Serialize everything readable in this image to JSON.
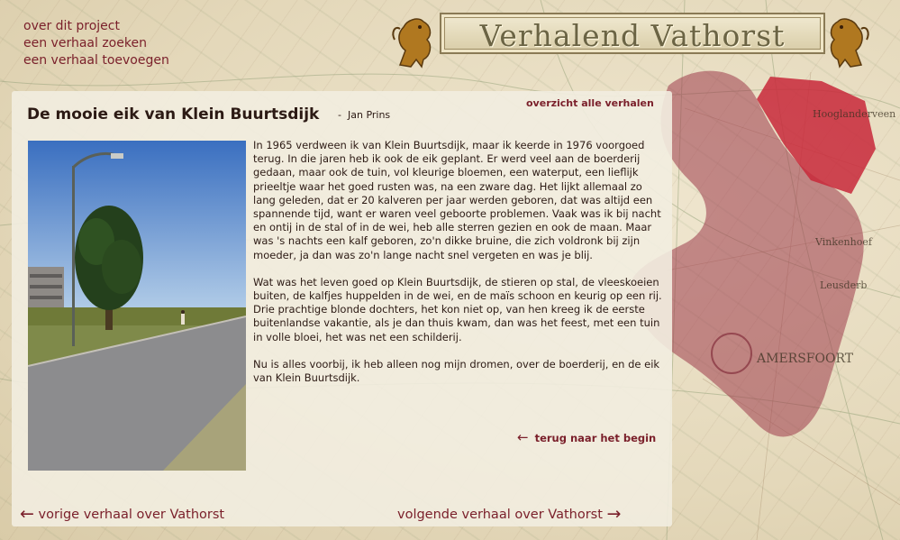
{
  "nav": {
    "items": [
      {
        "label": "over dit project"
      },
      {
        "label": "een verhaal zoeken"
      },
      {
        "label": "een verhaal toevoegen"
      }
    ]
  },
  "header": {
    "title": "Verhalend Vathorst"
  },
  "map": {
    "labels": [
      "Hooglanderveen",
      "Vinkenhoef",
      "Leusderb",
      "AMERSFOORT"
    ],
    "colors": {
      "region": "#9c3a4a",
      "highlight": "#c8283a"
    }
  },
  "story": {
    "title": "De mooie eik van Klein Buurtsdijk",
    "author_separator": "-",
    "author": "Jan Prins",
    "overview_link": "overzicht alle verhalen",
    "paragraphs": [
      "In 1965 verdween ik van Klein Buurtsdijk, maar ik keerde in 1976 voorgoed terug. In die jaren heb ik ook de eik geplant. Er werd veel aan de boerderij gedaan, maar ook de tuin, vol kleurige bloemen, een waterput, een lieflijk prieeltje waar het goed rusten was, na een zware dag. Het lijkt allemaal zo lang geleden, dat er 20 kalveren per jaar werden geboren, dat was altijd een spannende tijd, want er waren veel geboorte problemen. Vaak was ik bij nacht en ontij in de stal of in de wei, heb alle sterren gezien en ook de maan. Maar was 's nachts een kalf geboren, zo'n dikke bruine, die zich voldronk bij zijn moeder, ja dan was zo'n lange nacht snel vergeten en was je blij.",
      "Wat was het leven goed op Klein Buurtsdijk, de stieren op stal, de vleeskoeien buiten, de kalfjes huppelden in de wei, en de maïs schoon en keurig op een rij. Drie prachtige blonde dochters, het kon niet op, van hen kreeg ik de eerste buitenlandse vakantie, als je dan thuis kwam, dan was het feest, met een tuin in volle bloei, het was net een schilderij.",
      "Nu is alles voorbij, ik heb alleen nog mijn dromen, over de boerderij, en de eik van Klein Buurtsdijk."
    ],
    "back_link": "terug naar het begin"
  },
  "footer": {
    "prev_label": "vorige verhaal over Vathorst",
    "next_label": "volgende verhaal over Vathorst"
  },
  "colors": {
    "link": "#7a1f2a",
    "text": "#2c1a14",
    "panel": "#f2ede0"
  },
  "icons": {
    "arrow_left": "←",
    "arrow_right": "→"
  }
}
